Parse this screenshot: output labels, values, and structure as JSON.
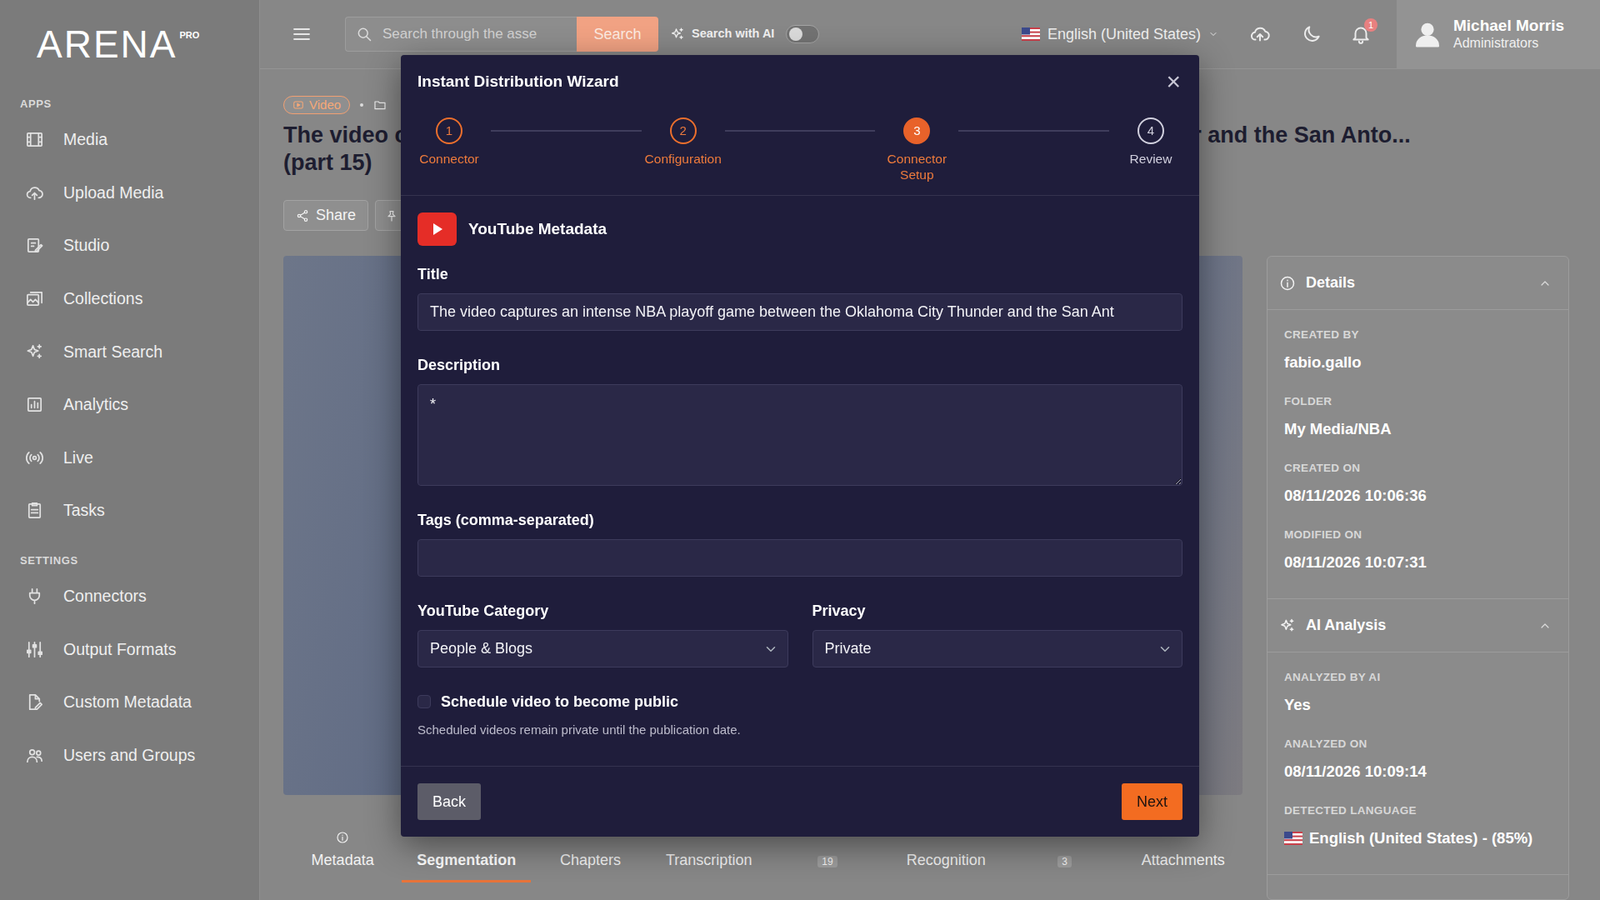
{
  "app": {
    "logo": "ARENA",
    "edition": "PRO"
  },
  "sidebar": {
    "sections": [
      {
        "heading": "APPS",
        "items": [
          {
            "label": "Media"
          },
          {
            "label": "Upload Media"
          },
          {
            "label": "Studio"
          },
          {
            "label": "Collections"
          },
          {
            "label": "Smart Search"
          },
          {
            "label": "Analytics"
          },
          {
            "label": "Live"
          },
          {
            "label": "Tasks"
          }
        ]
      },
      {
        "heading": "SETTINGS",
        "items": [
          {
            "label": "Connectors"
          },
          {
            "label": "Output Formats"
          },
          {
            "label": "Custom Metadata"
          },
          {
            "label": "Users and Groups"
          }
        ]
      }
    ]
  },
  "topbar": {
    "search": {
      "placeholder": "Search through the asse",
      "button": "Search"
    },
    "ai_search": {
      "label": "Search with AI",
      "on": false
    },
    "language": "English (United States)",
    "notifications": "1",
    "user": {
      "name": "Michael Morris",
      "role": "Administrators"
    }
  },
  "asset": {
    "type": "Video",
    "title_lines": [
      "The video captures an intense NBA playoff game between the Oklahoma City Thunder and the San Anto...",
      "(part 15)"
    ],
    "share": "Share"
  },
  "tabs": [
    {
      "label": "Metadata",
      "kind": "tab",
      "selected": false
    },
    {
      "label": "Segmentation",
      "kind": "tab",
      "selected": true
    },
    {
      "label": "Chapters",
      "kind": "tab",
      "selected": false
    },
    {
      "label": "Transcription",
      "kind": "tab",
      "selected": false
    },
    {
      "label": "19",
      "kind": "count",
      "selected": false
    },
    {
      "label": "Recognition",
      "kind": "tab",
      "selected": false
    },
    {
      "label": "3",
      "kind": "count",
      "selected": false
    },
    {
      "label": "Attachments",
      "kind": "tab",
      "selected": false
    }
  ],
  "details": {
    "sections": [
      {
        "title": "Details",
        "expanded": true,
        "fields": [
          {
            "label": "CREATED BY",
            "value": "fabio.gallo",
            "kind": "text"
          },
          {
            "label": "FOLDER",
            "value": "My Media/NBA",
            "kind": "text"
          },
          {
            "label": "CREATED ON",
            "value": "08/11/2026 10:06:36",
            "kind": "text"
          },
          {
            "label": "MODIFIED ON",
            "value": "08/11/2026 10:07:31",
            "kind": "text"
          }
        ]
      },
      {
        "title": "AI Analysis",
        "expanded": true,
        "fields": [
          {
            "label": "ANALYZED BY AI",
            "value": "Yes",
            "kind": "text"
          },
          {
            "label": "ANALYZED ON",
            "value": "08/11/2026 10:09:14",
            "kind": "text"
          },
          {
            "label": "DETECTED LANGUAGE",
            "value": "English (United States) - (85%)",
            "kind": "language"
          }
        ]
      }
    ]
  },
  "modal": {
    "title": "Instant Distribution Wizard",
    "close": "×",
    "steps": [
      {
        "number": "1",
        "label": "Connector",
        "state": "done"
      },
      {
        "number": "2",
        "label": "Configuration",
        "state": "done"
      },
      {
        "number": "3",
        "label": "Connector Setup",
        "state": "current"
      },
      {
        "number": "4",
        "label": "Review",
        "state": "pending"
      }
    ],
    "section": "YouTube Metadata",
    "fields": {
      "title": {
        "label": "Title",
        "value": "The video captures an intense NBA playoff game between the Oklahoma City Thunder and the San Ant"
      },
      "description": {
        "label": "Description",
        "value": "*"
      },
      "tags": {
        "label": "Tags (comma-separated)",
        "value": ""
      },
      "category": {
        "label": "YouTube Category",
        "value": "People & Blogs"
      },
      "privacy": {
        "label": "Privacy",
        "value": "Private"
      }
    },
    "schedule": {
      "label": "Schedule video to become public",
      "checked": false,
      "help": "Scheduled videos remain private until the publication date."
    },
    "buttons": {
      "back": "Back",
      "next": "Next"
    }
  }
}
